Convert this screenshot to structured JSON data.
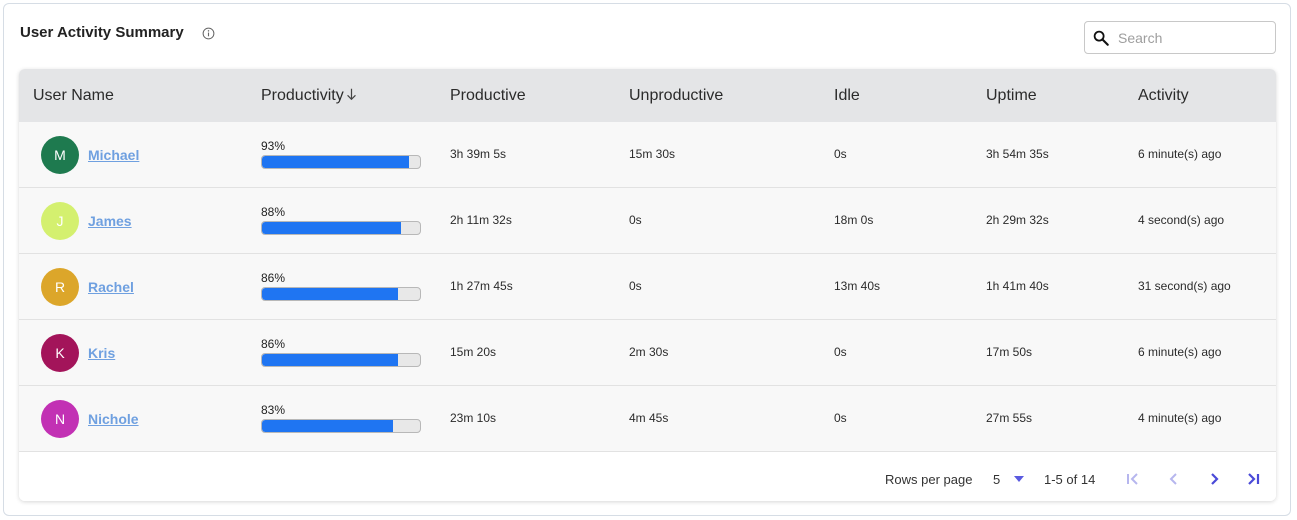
{
  "title": "User Activity Summary",
  "search": {
    "placeholder": "Search",
    "value": ""
  },
  "columns": {
    "user_name": "User Name",
    "productivity": "Productivity",
    "productive": "Productive",
    "unproductive": "Unproductive",
    "idle": "Idle",
    "uptime": "Uptime",
    "activity": "Activity"
  },
  "rows": [
    {
      "initial": "M",
      "avatar_color": "#1e7a4f",
      "name": "Michael",
      "productivity_pct": 93,
      "productivity_label": "93%",
      "productive": "3h 39m 5s",
      "unproductive": "15m 30s",
      "idle": "0s",
      "uptime": "3h 54m 35s",
      "activity": "6 minute(s) ago"
    },
    {
      "initial": "J",
      "avatar_color": "#d4f06f",
      "name": "James",
      "productivity_pct": 88,
      "productivity_label": "88%",
      "productive": "2h 11m 32s",
      "unproductive": "0s",
      "idle": "18m 0s",
      "uptime": "2h 29m 32s",
      "activity": "4 second(s) ago"
    },
    {
      "initial": "R",
      "avatar_color": "#dca62a",
      "name": "Rachel",
      "productivity_pct": 86,
      "productivity_label": "86%",
      "productive": "1h 27m 45s",
      "unproductive": "0s",
      "idle": "13m 40s",
      "uptime": "1h 41m 40s",
      "activity": "31 second(s) ago"
    },
    {
      "initial": "K",
      "avatar_color": "#a3145a",
      "name": "Kris",
      "productivity_pct": 86,
      "productivity_label": "86%",
      "productive": "15m 20s",
      "unproductive": "2m 30s",
      "idle": "0s",
      "uptime": "17m 50s",
      "activity": "6 minute(s) ago"
    },
    {
      "initial": "N",
      "avatar_color": "#c231b4",
      "name": "Nichole",
      "productivity_pct": 83,
      "productivity_label": "83%",
      "productive": "23m 10s",
      "unproductive": "4m 45s",
      "idle": "0s",
      "uptime": "27m 55s",
      "activity": "4 minute(s) ago"
    }
  ],
  "pagination": {
    "rows_per_page_label": "Rows per page",
    "rows_per_page": "5",
    "range": "1-5 of 14"
  },
  "colors": {
    "bar_fill": "#1f75f2",
    "link": "#6fa0e0",
    "pager_icon": "#5a5ae0"
  },
  "icons": {
    "info": "info-icon",
    "search": "search-icon",
    "sort": "arrow-down-icon",
    "first": "first-page-icon",
    "prev": "chevron-left-icon",
    "next": "chevron-right-icon",
    "last": "last-page-icon"
  }
}
